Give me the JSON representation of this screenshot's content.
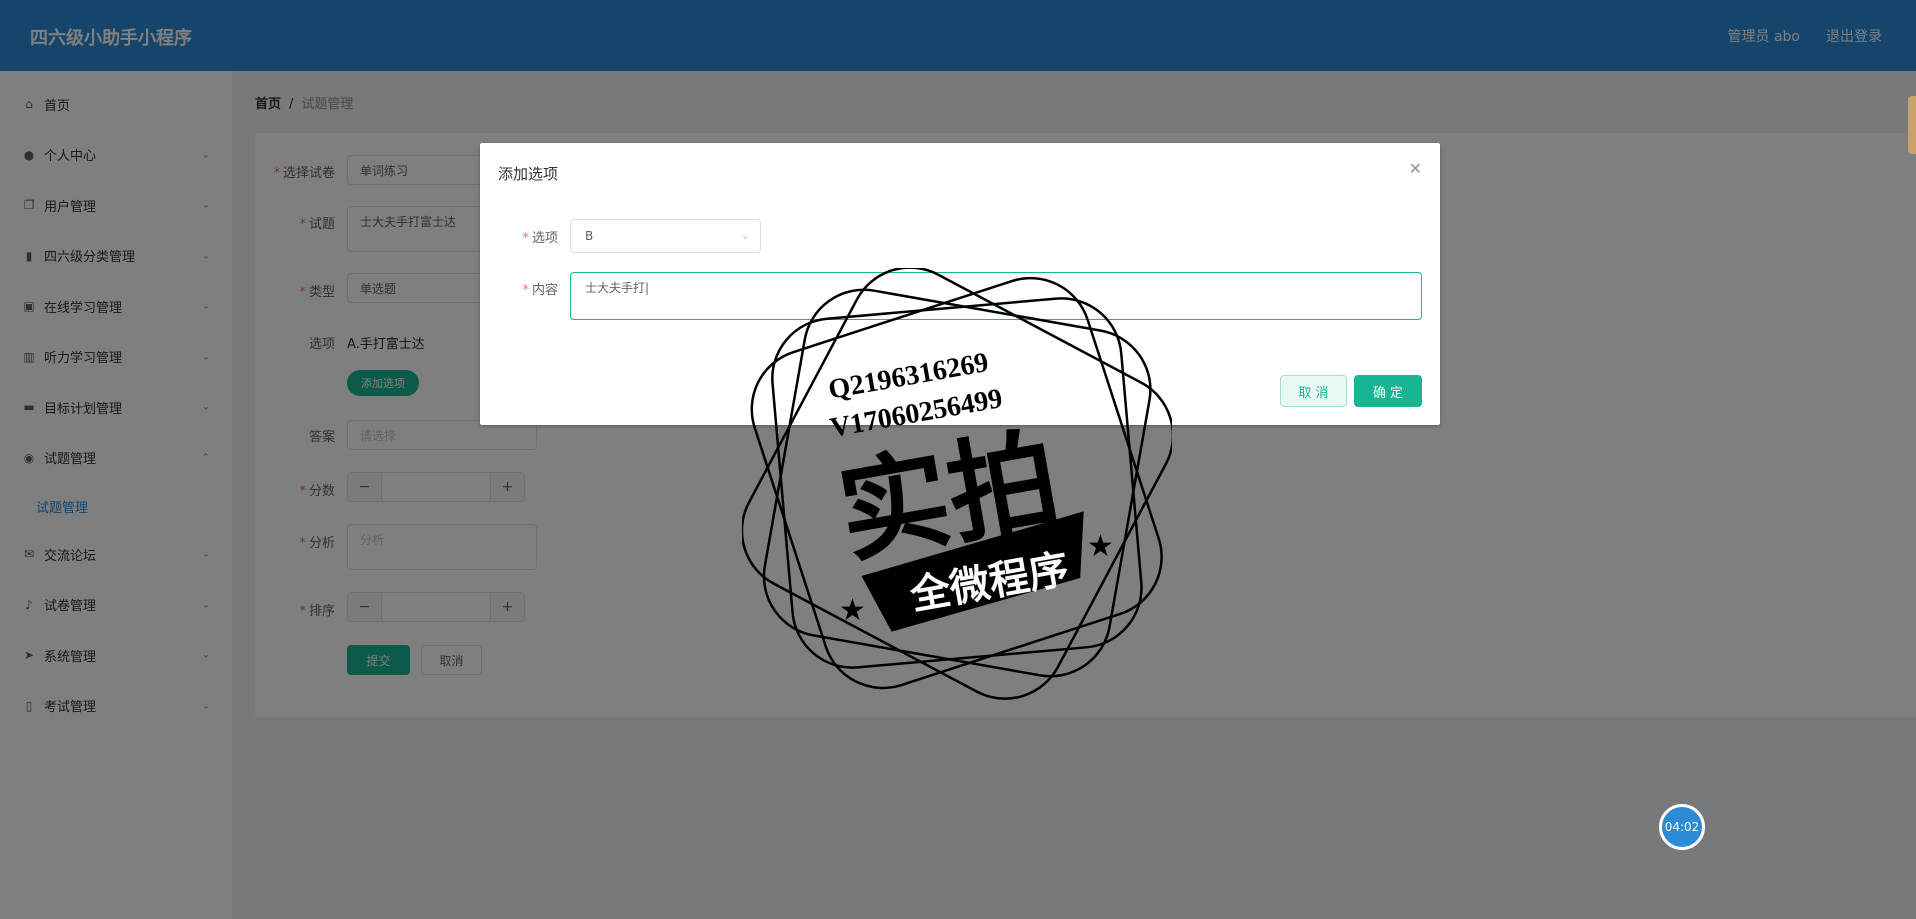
{
  "header": {
    "app_title": "四六级小助手小程序",
    "user": "管理员 abo",
    "logout": "退出登录"
  },
  "sidebar": {
    "items": [
      {
        "label": "首页",
        "icon": "home-icon"
      },
      {
        "label": "个人中心",
        "icon": "user-icon"
      },
      {
        "label": "用户管理",
        "icon": "copy-icon"
      },
      {
        "label": "四六级分类管理",
        "icon": "notebook-icon"
      },
      {
        "label": "在线学习管理",
        "icon": "clipboard-icon"
      },
      {
        "label": "听力学习管理",
        "icon": "bar-chart-icon"
      },
      {
        "label": "目标计划管理",
        "icon": "ticket-icon"
      },
      {
        "label": "试题管理",
        "icon": "location-icon",
        "sub": "试题管理"
      },
      {
        "label": "交流论坛",
        "icon": "message-icon"
      },
      {
        "label": "试卷管理",
        "icon": "bell-off-icon"
      },
      {
        "label": "系统管理",
        "icon": "send-icon"
      },
      {
        "label": "考试管理",
        "icon": "microphone-icon"
      }
    ]
  },
  "breadcrumb": {
    "home": "首页",
    "sep": "/",
    "current": "试题管理"
  },
  "form": {
    "paper_label": "选择试卷",
    "paper_value": "单词练习",
    "question_label": "试题",
    "question_value": "士大夫手打富士达",
    "type_label": "类型",
    "type_value": "单选题",
    "options_label": "选项",
    "option_item": "A.手打富士达",
    "add_option": "添加选项",
    "answer_label": "答案",
    "answer_placeholder": "请选择",
    "score_label": "分数",
    "analysis_label": "分析",
    "analysis_placeholder": "分析",
    "order_label": "排序",
    "submit": "提交",
    "cancel": "取消",
    "minus": "−",
    "plus": "+"
  },
  "dialog": {
    "title": "添加选项",
    "option_label": "选项",
    "option_value": "B",
    "content_label": "内容",
    "content_value": "士大夫手打|",
    "cancel": "取 消",
    "confirm": "确 定"
  },
  "watermark": {
    "line1": "Q2196316269",
    "line2": "V17060256499",
    "big": "实拍",
    "banner": "全微程序"
  },
  "timer": "04:02",
  "colors": {
    "header": "#2a8bd6",
    "accent": "#19b592",
    "required": "#f56c6c"
  }
}
